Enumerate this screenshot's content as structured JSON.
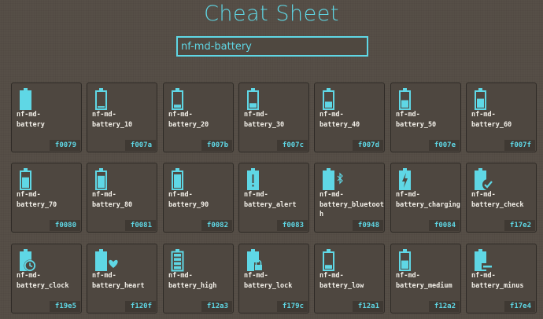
{
  "page": {
    "title": "Cheat Sheet"
  },
  "search": {
    "value": "nf-md-battery"
  },
  "colors": {
    "accent": "#5fd7e5",
    "background": "#564f47",
    "card": "#4e4740"
  },
  "icons": [
    {
      "name": "nf-md-battery",
      "code": "f0079",
      "icon": "battery-full-icon",
      "level": 1.0,
      "badge": "none"
    },
    {
      "name": "nf-md-battery_10",
      "code": "f007a",
      "icon": "battery-10-icon",
      "level": 0.1,
      "badge": "none"
    },
    {
      "name": "nf-md-battery_20",
      "code": "f007b",
      "icon": "battery-20-icon",
      "level": 0.2,
      "badge": "none"
    },
    {
      "name": "nf-md-battery_30",
      "code": "f007c",
      "icon": "battery-30-icon",
      "level": 0.3,
      "badge": "none"
    },
    {
      "name": "nf-md-battery_40",
      "code": "f007d",
      "icon": "battery-40-icon",
      "level": 0.4,
      "badge": "none"
    },
    {
      "name": "nf-md-battery_50",
      "code": "f007e",
      "icon": "battery-50-icon",
      "level": 0.5,
      "badge": "none"
    },
    {
      "name": "nf-md-battery_60",
      "code": "f007f",
      "icon": "battery-60-icon",
      "level": 0.6,
      "badge": "none"
    },
    {
      "name": "nf-md-battery_70",
      "code": "f0080",
      "icon": "battery-70-icon",
      "level": 0.7,
      "badge": "none"
    },
    {
      "name": "nf-md-battery_80",
      "code": "f0081",
      "icon": "battery-80-icon",
      "level": 0.8,
      "badge": "none"
    },
    {
      "name": "nf-md-battery_90",
      "code": "f0082",
      "icon": "battery-90-icon",
      "level": 0.9,
      "badge": "none"
    },
    {
      "name": "nf-md-battery_alert",
      "code": "f0083",
      "icon": "battery-alert-icon",
      "level": 1.0,
      "badge": "alert"
    },
    {
      "name": "nf-md-battery_bluetooth",
      "code": "f0948",
      "icon": "battery-bluetooth-icon",
      "level": 1.0,
      "badge": "bluetooth"
    },
    {
      "name": "nf-md-battery_charging",
      "code": "f0084",
      "icon": "battery-charging-icon",
      "level": 1.0,
      "badge": "charging"
    },
    {
      "name": "nf-md-battery_check",
      "code": "f17e2",
      "icon": "battery-check-icon",
      "level": 1.0,
      "badge": "check"
    },
    {
      "name": "nf-md-battery_clock",
      "code": "f19e5",
      "icon": "battery-clock-icon",
      "level": 1.0,
      "badge": "clock"
    },
    {
      "name": "nf-md-battery_heart",
      "code": "f120f",
      "icon": "battery-heart-icon",
      "level": 1.0,
      "badge": "heart"
    },
    {
      "name": "nf-md-battery_high",
      "code": "f12a3",
      "icon": "battery-high-icon",
      "level": 1.0,
      "badge": "high"
    },
    {
      "name": "nf-md-battery_lock",
      "code": "f179c",
      "icon": "battery-lock-icon",
      "level": 1.0,
      "badge": "lock"
    },
    {
      "name": "nf-md-battery_low",
      "code": "f12a1",
      "icon": "battery-low-icon",
      "level": 0.25,
      "badge": "outline"
    },
    {
      "name": "nf-md-battery_medium",
      "code": "f12a2",
      "icon": "battery-medium-icon",
      "level": 0.55,
      "badge": "outline"
    },
    {
      "name": "nf-md-battery_minus",
      "code": "f17e4",
      "icon": "battery-minus-icon",
      "level": 1.0,
      "badge": "minus"
    }
  ]
}
